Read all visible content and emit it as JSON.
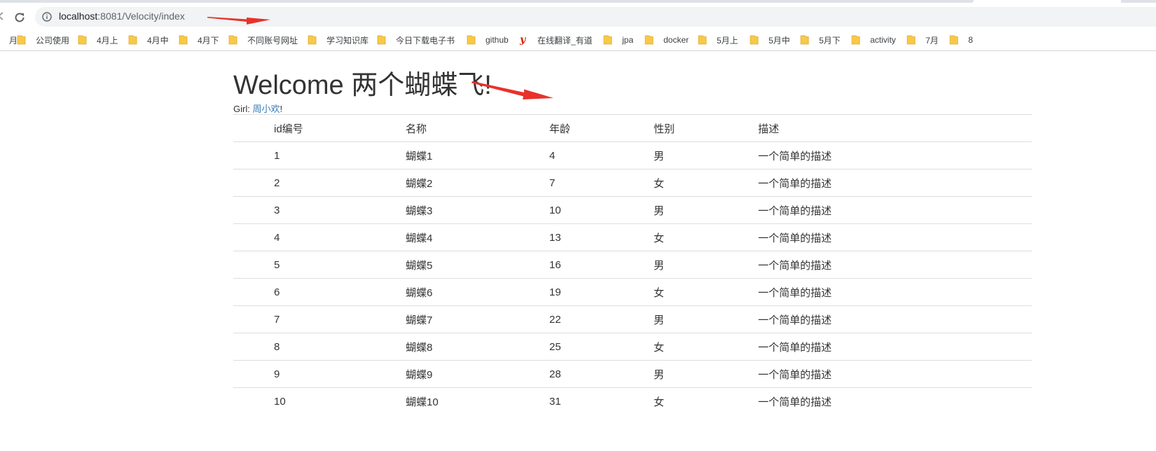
{
  "browser": {
    "url_host": "localhost",
    "url_rest": ":8081/Velocity/index"
  },
  "bookmarks": [
    {
      "label": "月",
      "icon": "folder-icon"
    },
    {
      "label": "公司使用",
      "icon": "folder-icon"
    },
    {
      "label": "4月上",
      "icon": "folder-icon"
    },
    {
      "label": "4月中",
      "icon": "folder-icon"
    },
    {
      "label": "4月下",
      "icon": "folder-icon"
    },
    {
      "label": "不同账号网址",
      "icon": "folder-icon"
    },
    {
      "label": "学习知识库",
      "icon": "folder-icon"
    },
    {
      "label": "今日下载电子书",
      "icon": "folder-icon"
    },
    {
      "label": "github",
      "icon": "folder-icon"
    },
    {
      "label": "在线翻译_有道",
      "icon": "youdao-icon"
    },
    {
      "label": "jpa",
      "icon": "folder-icon"
    },
    {
      "label": "docker",
      "icon": "folder-icon"
    },
    {
      "label": "5月上",
      "icon": "folder-icon"
    },
    {
      "label": "5月中",
      "icon": "folder-icon"
    },
    {
      "label": "5月下",
      "icon": "folder-icon"
    },
    {
      "label": "activity",
      "icon": "folder-icon"
    },
    {
      "label": "7月",
      "icon": "folder-icon"
    },
    {
      "label": "8",
      "icon": "folder-icon"
    }
  ],
  "page": {
    "title": "Welcome 两个蝴蝶飞!",
    "girl_label": "Girl: ",
    "girl_name": "周小欢",
    "girl_suffix": "!"
  },
  "table": {
    "headers": [
      "id编号",
      "名称",
      "年龄",
      "性别",
      "描述"
    ],
    "rows": [
      [
        "1",
        "蝴蝶1",
        "4",
        "男",
        "一个简单的描述"
      ],
      [
        "2",
        "蝴蝶2",
        "7",
        "女",
        "一个简单的描述"
      ],
      [
        "3",
        "蝴蝶3",
        "10",
        "男",
        "一个简单的描述"
      ],
      [
        "4",
        "蝴蝶4",
        "13",
        "女",
        "一个简单的描述"
      ],
      [
        "5",
        "蝴蝶5",
        "16",
        "男",
        "一个简单的描述"
      ],
      [
        "6",
        "蝴蝶6",
        "19",
        "女",
        "一个简单的描述"
      ],
      [
        "7",
        "蝴蝶7",
        "22",
        "男",
        "一个简单的描述"
      ],
      [
        "8",
        "蝴蝶8",
        "25",
        "女",
        "一个简单的描述"
      ],
      [
        "9",
        "蝴蝶9",
        "28",
        "男",
        "一个简单的描述"
      ],
      [
        "10",
        "蝴蝶10",
        "31",
        "女",
        "一个简单的描述"
      ]
    ]
  },
  "colors": {
    "link": "#337ab7",
    "annotation_arrow": "#e8322a",
    "folder": "#f7c948",
    "row_border": "#dddddd"
  }
}
